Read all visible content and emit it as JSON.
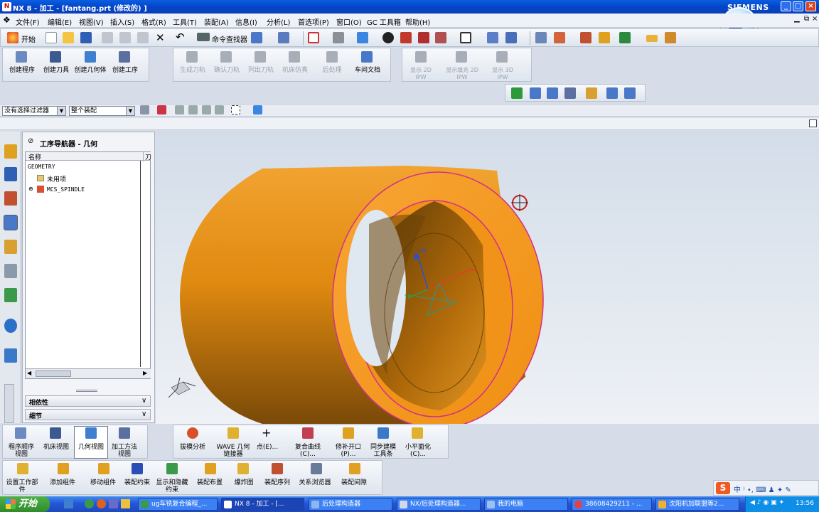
{
  "title_bar": {
    "title": "NX 8 - 加工 - [fantang.prt  (修改的) ]",
    "brand": "SIEMENS"
  },
  "menu": [
    "文件(F)",
    "编辑(E)",
    "视图(V)",
    "插入(S)",
    "格式(R)",
    "工具(T)",
    "装配(A)",
    "信息(I)",
    "分析(L)",
    "首选项(P)",
    "窗口(O)",
    "GC 工具箱",
    "帮助(H)"
  ],
  "toolbar": {
    "start_label": "开始",
    "command_finder": "命令查找器"
  },
  "insert_toolbar": [
    "创建程序",
    "创建刀具",
    "创建几何体",
    "创建工序"
  ],
  "operation_toolbar": [
    "生成刀轨",
    "确认刀轨",
    "列出刀轨",
    "机床仿真",
    "后处理",
    "车间文档"
  ],
  "ipw_toolbar": [
    "显示 2D IPW",
    "显示填充 2D IPW",
    "显示 3D IPW"
  ],
  "selection_bar": {
    "filter": "没有选择过滤器",
    "scope": "整个装配"
  },
  "navigator": {
    "title": "工序导航器 - 几何",
    "columns": [
      "名称",
      "刀"
    ],
    "rows": [
      {
        "name": "GEOMETRY",
        "level": 0
      },
      {
        "name": "未用项",
        "level": 1
      },
      {
        "name": "MCS_SPINDLE",
        "level": 1
      }
    ],
    "panels": [
      "相依性",
      "细节"
    ]
  },
  "viewport": {
    "axis_labels": {
      "zm": "ZM",
      "xm": "XM",
      "ym": "YM"
    },
    "colors": {
      "part": "#f39a10",
      "edge": "#d0308a",
      "background_top": "#d3dde9",
      "background_bottom": "#eef1f5"
    }
  },
  "nav_toolbar": [
    "程序顺序视图",
    "机床视图",
    "几何视图",
    "加工方法视图"
  ],
  "analysis_toolbar": [
    "拔模分析",
    "WAVE 几何链接器",
    "点(E)...",
    "复合曲线(C)...",
    "修补开口(P)...",
    "同步建模工具条",
    "小平面化(C)..."
  ],
  "assembly_toolbar": [
    "设置工作部件",
    "添加组件",
    "移动组件",
    "装配约束",
    "显示和隐藏约束",
    "装配布置",
    "爆炸图",
    "装配序列",
    "关系浏览器",
    "装配间隙"
  ],
  "taskbar": {
    "start": "开始",
    "tasks": [
      "ug车铣复合编程_...",
      "NX 8 - 加工 - [...",
      "后处理构造器",
      "NX/后处理构造器...",
      "我的电脑",
      "38608429211 - ...",
      "沈阳机加联盟等2..."
    ],
    "clock": "13:56"
  }
}
